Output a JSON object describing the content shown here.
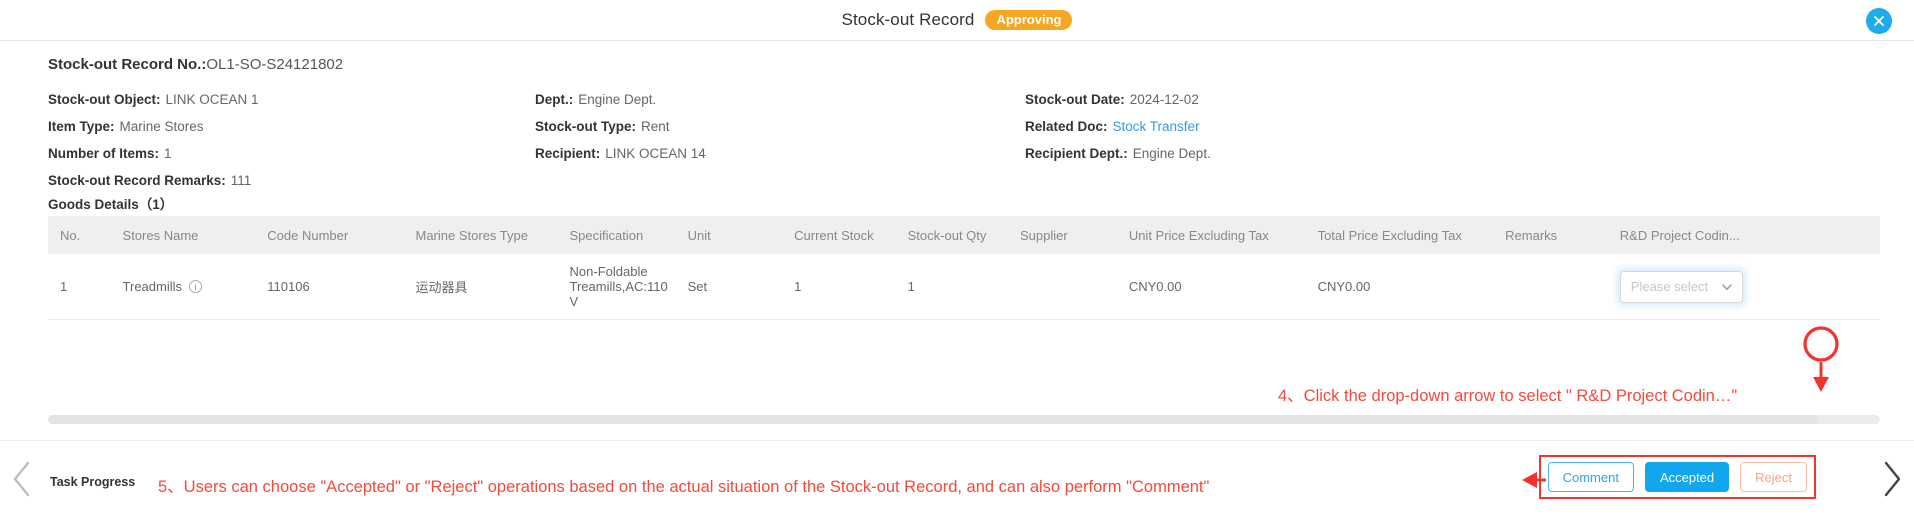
{
  "header": {
    "title": "Stock-out Record",
    "status": "Approving",
    "close_icon": "close-circle-icon"
  },
  "record": {
    "no_label": "Stock-out Record No.:",
    "no_value": "OL1-SO-S24121802",
    "fields": [
      {
        "label": "Stock-out Object:",
        "value": "LINK OCEAN 1"
      },
      {
        "label": "Dept.:",
        "value": "Engine Dept."
      },
      {
        "label": "Stock-out Date:",
        "value": "2024-12-02"
      },
      {
        "label": "Item Type:",
        "value": "Marine Stores"
      },
      {
        "label": "Stock-out Type:",
        "value": "Rent"
      },
      {
        "label": "Related Doc:",
        "value": "Stock Transfer",
        "link": true
      },
      {
        "label": "Number of Items:",
        "value": "1"
      },
      {
        "label": "Recipient:",
        "value": "LINK OCEAN 14"
      },
      {
        "label": "Recipient Dept.:",
        "value": "Engine Dept."
      },
      {
        "label": "Stock-out Record Remarks:",
        "value": "111"
      }
    ]
  },
  "goods": {
    "section_title": "Goods Details（1）",
    "columns": [
      "No.",
      "Stores Name",
      "Code Number",
      "Marine Stores Type",
      "Specification",
      "Unit",
      "Current Stock",
      "Stock-out Qty",
      "Supplier",
      "Unit Price Excluding Tax",
      "Total Price Excluding Tax",
      "Remarks",
      "R&D Project Codin..."
    ],
    "rows": [
      {
        "no": "1",
        "stores_name": "Treadmills",
        "code_number": "110106",
        "marine_stores_type": "运动器具",
        "specification": "Non-Foldable Treamills,AC:110V",
        "unit": "Set",
        "current_stock": "1",
        "stock_out_qty": "1",
        "supplier": "",
        "unit_price": "CNY0.00",
        "total_price": "CNY0.00",
        "remarks": "",
        "rd_project_placeholder": "Please select"
      }
    ]
  },
  "footer": {
    "task_progress": "Task Progress",
    "buttons": {
      "comment": "Comment",
      "accepted": "Accepted",
      "reject": "Reject"
    },
    "prev_icon": "chevron-left-icon",
    "next_icon": "chevron-right-icon"
  },
  "annotations": {
    "step4": "4、Click the drop-down arrow to select \" R&D Project Codin…\"",
    "step5": "5、Users can choose \"Accepted\" or \"Reject\" operations based on the actual situation of the Stock-out Record, and can also perform \"Comment\""
  },
  "colors": {
    "accent": "#11a6ee",
    "status_pill": "#f5a623",
    "annotation_red": "#f4493c",
    "link": "#3a9ae0"
  }
}
